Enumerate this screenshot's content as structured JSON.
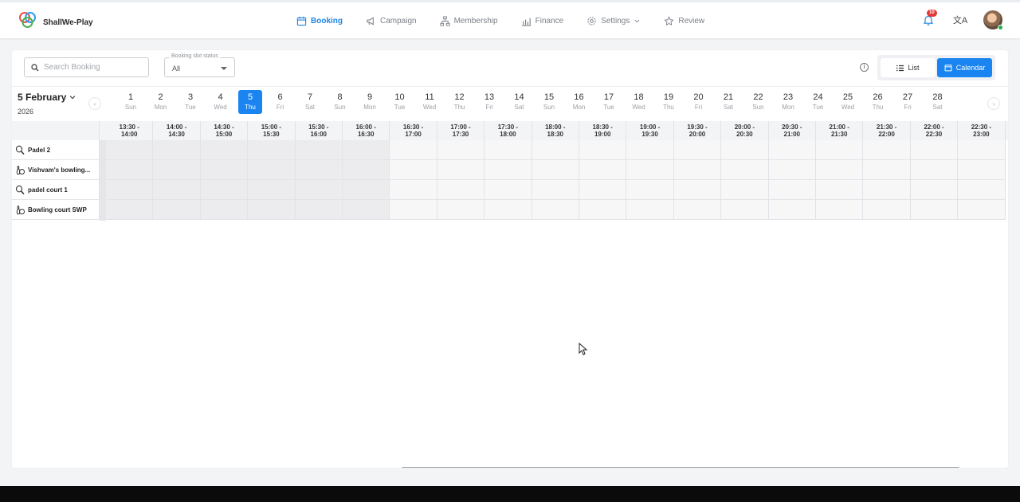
{
  "brand": {
    "name": "ShallWe-Play",
    "logo_icon": "interlocking-rings-logo"
  },
  "nav": {
    "items": [
      {
        "label": "Booking",
        "icon": "calendar-icon",
        "active": true
      },
      {
        "label": "Campaign",
        "icon": "megaphone-icon",
        "active": false
      },
      {
        "label": "Membership",
        "icon": "org-chart-icon",
        "active": false
      },
      {
        "label": "Finance",
        "icon": "chart-icon",
        "active": false
      },
      {
        "label": "Settings",
        "icon": "gear-icon",
        "active": false
      },
      {
        "label": "Review",
        "icon": "star-icon",
        "active": false
      }
    ]
  },
  "header_right": {
    "notification_count": "10",
    "translate_glyph": "文A"
  },
  "toolbar": {
    "search_placeholder": "Search Booking",
    "status_label": "Booking slot status",
    "status_value": "All",
    "info_glyph": "i",
    "list_label": "List",
    "calendar_label": "Calendar"
  },
  "calendar": {
    "month_label": "5 February",
    "year_label": "2026",
    "prev_glyph": "‹",
    "next_glyph": "›",
    "days": [
      {
        "n": "1",
        "w": "Sun"
      },
      {
        "n": "2",
        "w": "Mon"
      },
      {
        "n": "3",
        "w": "Tue"
      },
      {
        "n": "4",
        "w": "Wed"
      },
      {
        "n": "5",
        "w": "Thu",
        "selected": true
      },
      {
        "n": "6",
        "w": "Fri"
      },
      {
        "n": "7",
        "w": "Sat"
      },
      {
        "n": "8",
        "w": "Sun"
      },
      {
        "n": "9",
        "w": "Mon"
      },
      {
        "n": "10",
        "w": "Tue"
      },
      {
        "n": "11",
        "w": "Wed"
      },
      {
        "n": "12",
        "w": "Thu"
      },
      {
        "n": "13",
        "w": "Fri"
      },
      {
        "n": "14",
        "w": "Sat"
      },
      {
        "n": "15",
        "w": "Sun"
      },
      {
        "n": "16",
        "w": "Mon"
      },
      {
        "n": "17",
        "w": "Tue"
      },
      {
        "n": "18",
        "w": "Wed"
      },
      {
        "n": "19",
        "w": "Thu"
      },
      {
        "n": "20",
        "w": "Fri"
      },
      {
        "n": "21",
        "w": "Sat"
      },
      {
        "n": "22",
        "w": "Sun"
      },
      {
        "n": "23",
        "w": "Mon"
      },
      {
        "n": "24",
        "w": "Tue"
      },
      {
        "n": "25",
        "w": "Wed"
      },
      {
        "n": "26",
        "w": "Thu"
      },
      {
        "n": "27",
        "w": "Fri"
      },
      {
        "n": "28",
        "w": "Sat"
      }
    ]
  },
  "schedule": {
    "slots": [
      {
        "start": "13:30 -",
        "end": "14:00",
        "past": true
      },
      {
        "start": "14:00 -",
        "end": "14:30",
        "past": true
      },
      {
        "start": "14:30 -",
        "end": "15:00",
        "past": true
      },
      {
        "start": "15:00 -",
        "end": "15:30",
        "past": true
      },
      {
        "start": "15:30 -",
        "end": "16:00",
        "past": true
      },
      {
        "start": "16:00 -",
        "end": "16:30",
        "past": true
      },
      {
        "start": "16:30 -",
        "end": "17:00",
        "past": false
      },
      {
        "start": "17:00 -",
        "end": "17:30",
        "past": false
      },
      {
        "start": "17:30 -",
        "end": "18:00",
        "past": false
      },
      {
        "start": "18:00 -",
        "end": "18:30",
        "past": false
      },
      {
        "start": "18:30 -",
        "end": "19:00",
        "past": false
      },
      {
        "start": "19:00 -",
        "end": "19:30",
        "past": false
      },
      {
        "start": "19:30 -",
        "end": "20:00",
        "past": false
      },
      {
        "start": "20:00 -",
        "end": "20:30",
        "past": false
      },
      {
        "start": "20:30 -",
        "end": "21:00",
        "past": false
      },
      {
        "start": "21:00 -",
        "end": "21:30",
        "past": false
      },
      {
        "start": "21:30 -",
        "end": "22:00",
        "past": false
      },
      {
        "start": "22:00 -",
        "end": "22:30",
        "past": false
      },
      {
        "start": "22:30 -",
        "end": "23:00",
        "past": false
      }
    ],
    "resources": [
      {
        "name": "Padel 2",
        "icon": "padel-racket-icon"
      },
      {
        "name": "Vishvam's bowling...",
        "icon": "bowling-icon"
      },
      {
        "name": "padel court 1",
        "icon": "padel-racket-icon"
      },
      {
        "name": "Bowling court SWP",
        "icon": "bowling-icon"
      }
    ]
  },
  "colors": {
    "accent": "#1a84f0",
    "nav_active": "#1f86e5",
    "badge": "#e53935",
    "online": "#22b14c"
  }
}
